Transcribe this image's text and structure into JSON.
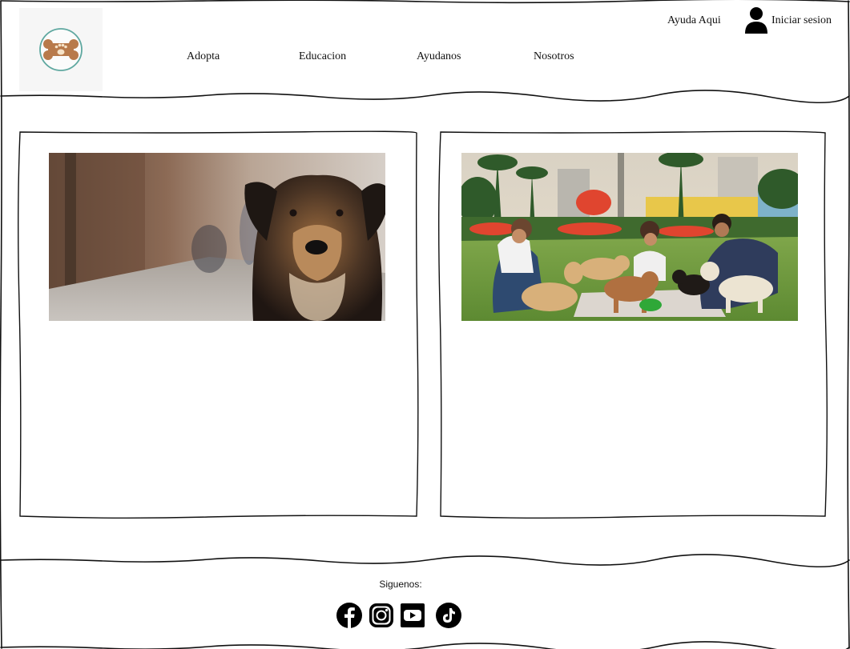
{
  "header": {
    "help_link": "Ayuda Aqui",
    "login_label": "Iniciar sesion",
    "logo_icon": "paw-bone-logo-icon",
    "nav": [
      {
        "label": "Adopta"
      },
      {
        "label": "Educacion"
      },
      {
        "label": "Ayudanos"
      },
      {
        "label": "Nosotros"
      }
    ]
  },
  "cards": [
    {
      "image": "dog-portrait-street"
    },
    {
      "image": "volunteers-feeding-dogs-park"
    }
  ],
  "footer": {
    "follow_label": "Siguenos:",
    "social": [
      "facebook-icon",
      "instagram-icon",
      "youtube-icon",
      "tiktok-icon"
    ]
  },
  "colors": {
    "logo_bone": "#b87a4b",
    "logo_ring": "#5fa8a0",
    "ink": "#111111"
  }
}
